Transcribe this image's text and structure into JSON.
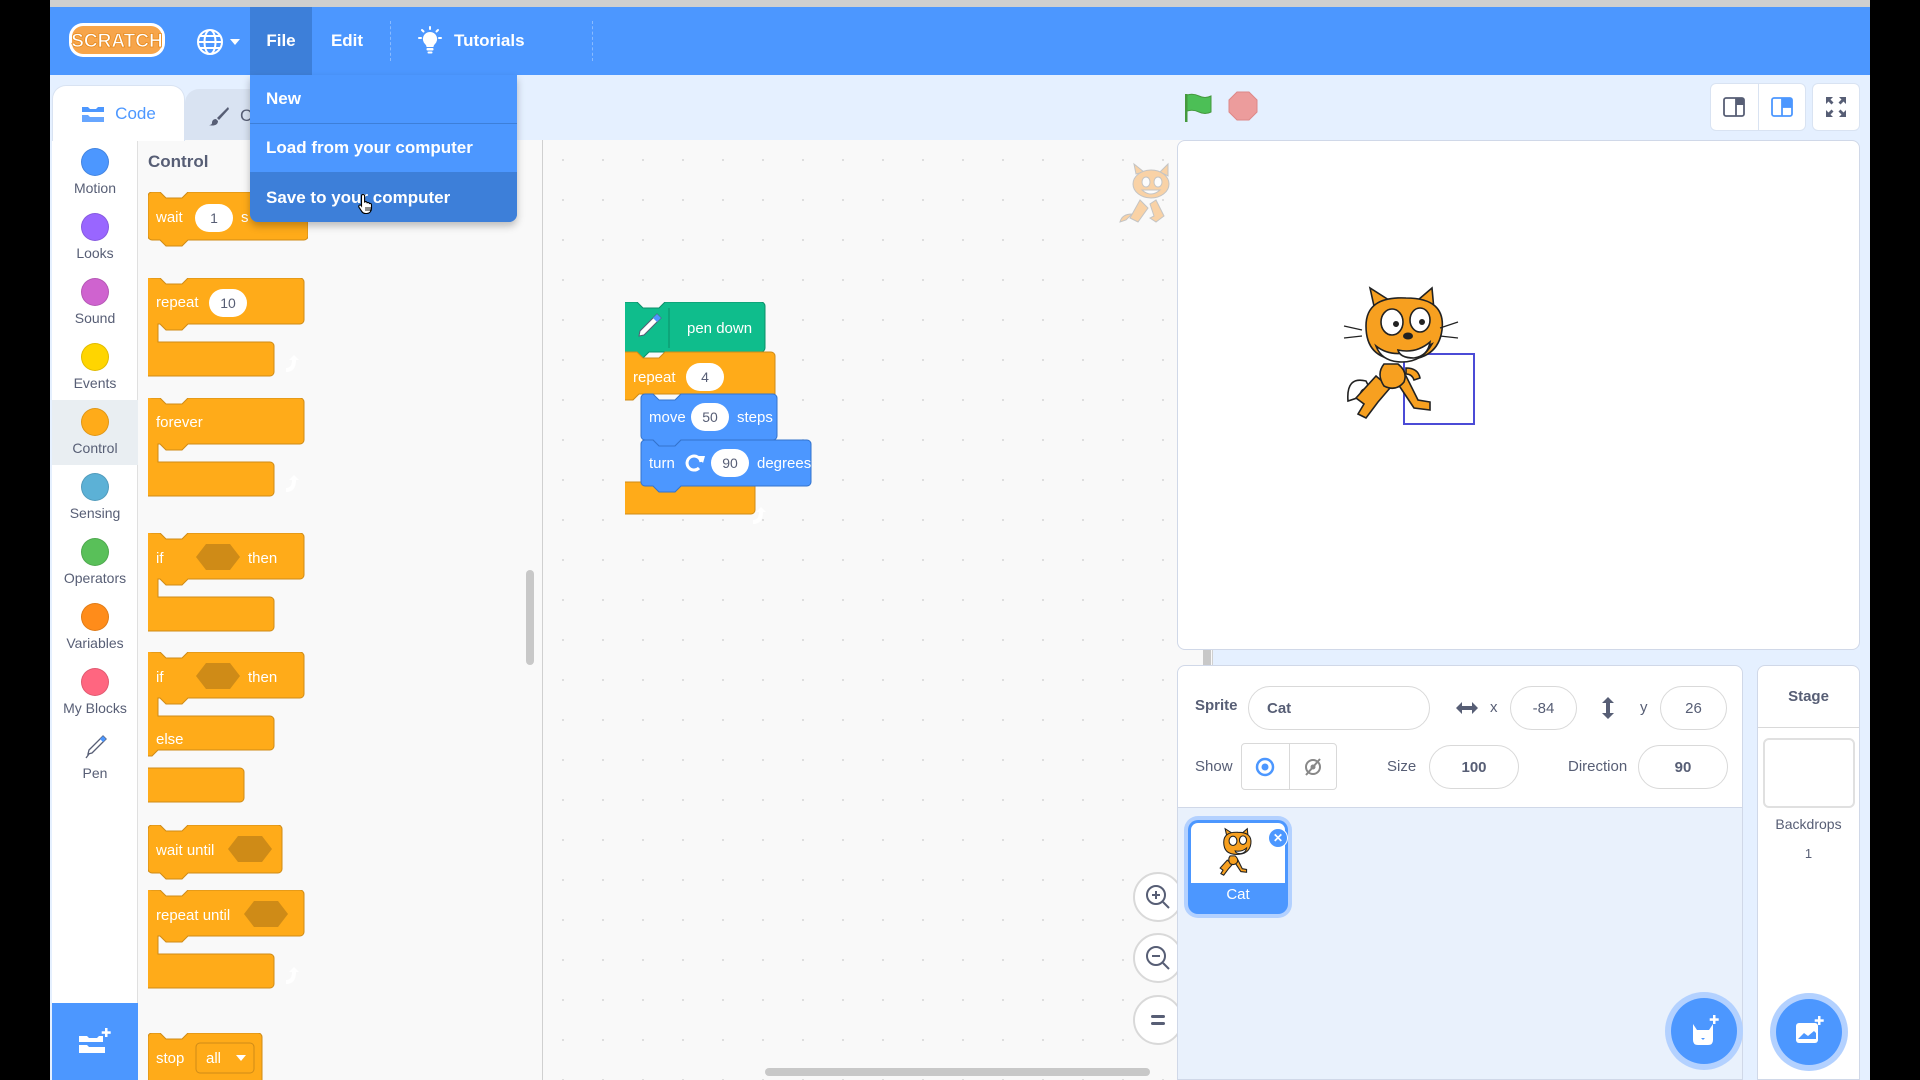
{
  "menubar": {
    "logo_text": "SCRATCH",
    "language_icon": "globe-icon",
    "file_label": "File",
    "edit_label": "Edit",
    "tutorials_label": "Tutorials"
  },
  "file_menu": {
    "items": [
      {
        "label": "New"
      },
      {
        "label": "Load from your computer"
      },
      {
        "label": "Save to your computer",
        "hovered": true
      }
    ]
  },
  "tabs": {
    "code_label": "Code",
    "costumes_label": "C"
  },
  "categories": [
    {
      "label": "Motion",
      "color": "#4C97FF"
    },
    {
      "label": "Looks",
      "color": "#9966FF"
    },
    {
      "label": "Sound",
      "color": "#CF63CF"
    },
    {
      "label": "Events",
      "color": "#FFD500"
    },
    {
      "label": "Control",
      "color": "#FFAB19",
      "selected": true
    },
    {
      "label": "Sensing",
      "color": "#5CB1D6"
    },
    {
      "label": "Operators",
      "color": "#59C059"
    },
    {
      "label": "Variables",
      "color": "#FF8C1A"
    },
    {
      "label": "My Blocks",
      "color": "#FF6680"
    },
    {
      "label": "Pen",
      "icon": "pen-icon"
    }
  ],
  "palette": {
    "title": "Control",
    "blocks": {
      "wait": {
        "label": "wait",
        "value": "1",
        "suffix": "s"
      },
      "repeat": {
        "label": "repeat",
        "value": "10"
      },
      "forever": {
        "label": "forever"
      },
      "if_then": {
        "if": "if",
        "then": "then"
      },
      "if_else": {
        "if": "if",
        "then": "then",
        "else": "else"
      },
      "wait_until": {
        "label": "wait until"
      },
      "repeat_until": {
        "label": "repeat until"
      },
      "stop": {
        "label": "stop",
        "option": "all"
      }
    }
  },
  "script": {
    "pen_down": "pen down",
    "repeat_label": "repeat",
    "repeat_value": "4",
    "move_label": "move",
    "move_value": "50",
    "move_suffix": "steps",
    "turn_label": "turn",
    "turn_value": "90",
    "turn_suffix": "degrees"
  },
  "colors": {
    "brand_blue": "#4C97FF",
    "menu_active": "#3D7FD9",
    "control_orange": "#FFAB19",
    "control_dark": "#CF8B17",
    "pen_green": "#0FBD8C",
    "motion_blue": "#4C97FF",
    "flag_green": "#45993D",
    "stop_red": "#EC9C9C"
  },
  "sprite_info": {
    "sprite_label": "Sprite",
    "sprite_name": "Cat",
    "x_label": "x",
    "x_value": "-84",
    "y_label": "y",
    "y_value": "26",
    "show_label": "Show",
    "size_label": "Size",
    "size_value": "100",
    "direction_label": "Direction",
    "direction_value": "90"
  },
  "sprites": [
    {
      "name": "Cat",
      "selected": true
    }
  ],
  "stage_pane": {
    "title": "Stage",
    "backdrops_label": "Backdrops",
    "backdrops_count": "1"
  }
}
